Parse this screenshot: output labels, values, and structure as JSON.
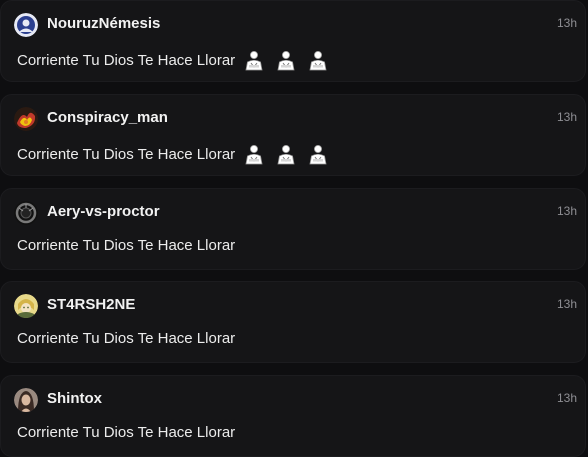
{
  "comments": [
    {
      "username": "NouruzNémesis",
      "time": "13h",
      "text": "Corriente Tu Dios Te Hace Llorar",
      "emojis": [
        "person-icon",
        "person-icon",
        "person-icon"
      ],
      "avatar_colors": [
        "#2b3f8f",
        "#e6e9f5"
      ]
    },
    {
      "username": "Conspiracy_man",
      "time": "13h",
      "text": "Corriente Tu Dios Te Hace Llorar",
      "emojis": [
        "person-icon",
        "person-icon",
        "person-icon"
      ],
      "avatar_colors": [
        "#c0392b",
        "#f1c40f"
      ]
    },
    {
      "username": "Aery-vs-proctor",
      "time": "13h",
      "text": "Corriente Tu Dios Te Hace Llorar",
      "emojis": [],
      "avatar_colors": [
        "#222222",
        "#7a7a7a"
      ]
    },
    {
      "username": "ST4RSH2NE",
      "time": "13h",
      "text": "Corriente Tu Dios Te Hace Llorar",
      "emojis": [],
      "avatar_colors": [
        "#d4b44a",
        "#5a6b3a"
      ]
    },
    {
      "username": "Shintox",
      "time": "13h",
      "text": "Corriente Tu Dios Te Hace Llorar",
      "emojis": [],
      "avatar_colors": [
        "#3a2a24",
        "#d9b8a0"
      ]
    }
  ]
}
